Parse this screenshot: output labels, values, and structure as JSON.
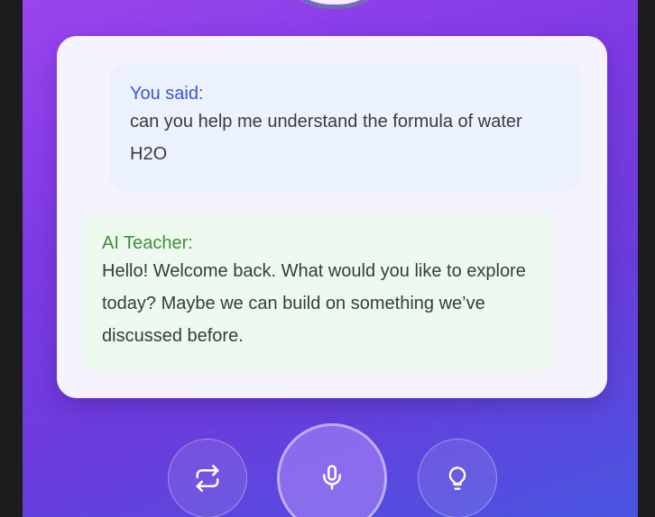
{
  "conversation": {
    "user_message": {
      "label": "You said:",
      "text": "can you help me understand the formula of water H2O"
    },
    "ai_message": {
      "label": "AI Teacher:",
      "text": "Hello! Welcome back. What would you like to explore today? Maybe we can build on something we’ve discussed before."
    }
  },
  "controls": [
    {
      "name": "swap-button",
      "icon": "arrows-swap-icon"
    },
    {
      "name": "microphone-button",
      "icon": "microphone-icon"
    },
    {
      "name": "hint-button",
      "icon": "lightbulb-icon"
    }
  ],
  "colors": {
    "background_gradient": [
      "#9a45ee",
      "#6a3cdc",
      "#4a55e0"
    ],
    "user_label": "#3a55d6",
    "ai_label": "#3f8d3c",
    "user_bubble": "#ebf2fd",
    "ai_bubble": "#eefaf0",
    "card": "#f5f3fd"
  }
}
